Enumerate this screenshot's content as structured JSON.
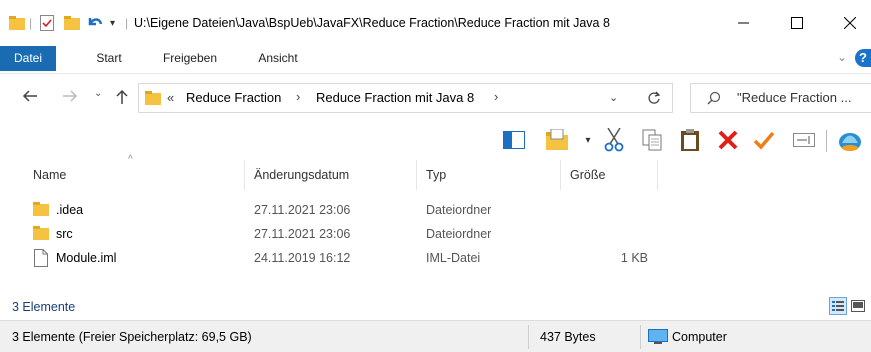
{
  "window": {
    "title": "U:\\Eigene Dateien\\Java\\BspUeb\\JavaFX\\Reduce Fraction\\Reduce Fraction mit Java 8"
  },
  "ribbon": {
    "tabs": [
      {
        "label": "Datei",
        "active": true
      },
      {
        "label": "Start",
        "active": false
      },
      {
        "label": "Freigeben",
        "active": false
      },
      {
        "label": "Ansicht",
        "active": false
      }
    ],
    "help_label": "?"
  },
  "address": {
    "overflow": "«",
    "crumbs": [
      "Reduce Fraction",
      "Reduce Fraction mit Java 8"
    ],
    "search_placeholder": "\"Reduce Fraction ..."
  },
  "columns": {
    "name": "Name",
    "date": "Änderungsdatum",
    "type": "Typ",
    "size": "Größe"
  },
  "files": [
    {
      "name": ".idea",
      "date": "27.11.2021 23:06",
      "type": "Dateiordner",
      "size": "",
      "icon": "folder-icon"
    },
    {
      "name": "src",
      "date": "27.11.2021 23:06",
      "type": "Dateiordner",
      "size": "",
      "icon": "folder-icon"
    },
    {
      "name": "Module.iml",
      "date": "24.11.2019 16:12",
      "type": "IML-Datei",
      "size": "1 KB",
      "icon": "file-icon"
    }
  ],
  "item_count": "3 Elemente",
  "status": {
    "left": "3 Elemente (Freier Speicherplatz: 69,5 GB)",
    "size": "437 Bytes",
    "location": "Computer"
  },
  "colors": {
    "active_tab": "#1a6cb2",
    "folder": "#f5c242",
    "delete": "#e0201a",
    "check": "#f07d16"
  }
}
